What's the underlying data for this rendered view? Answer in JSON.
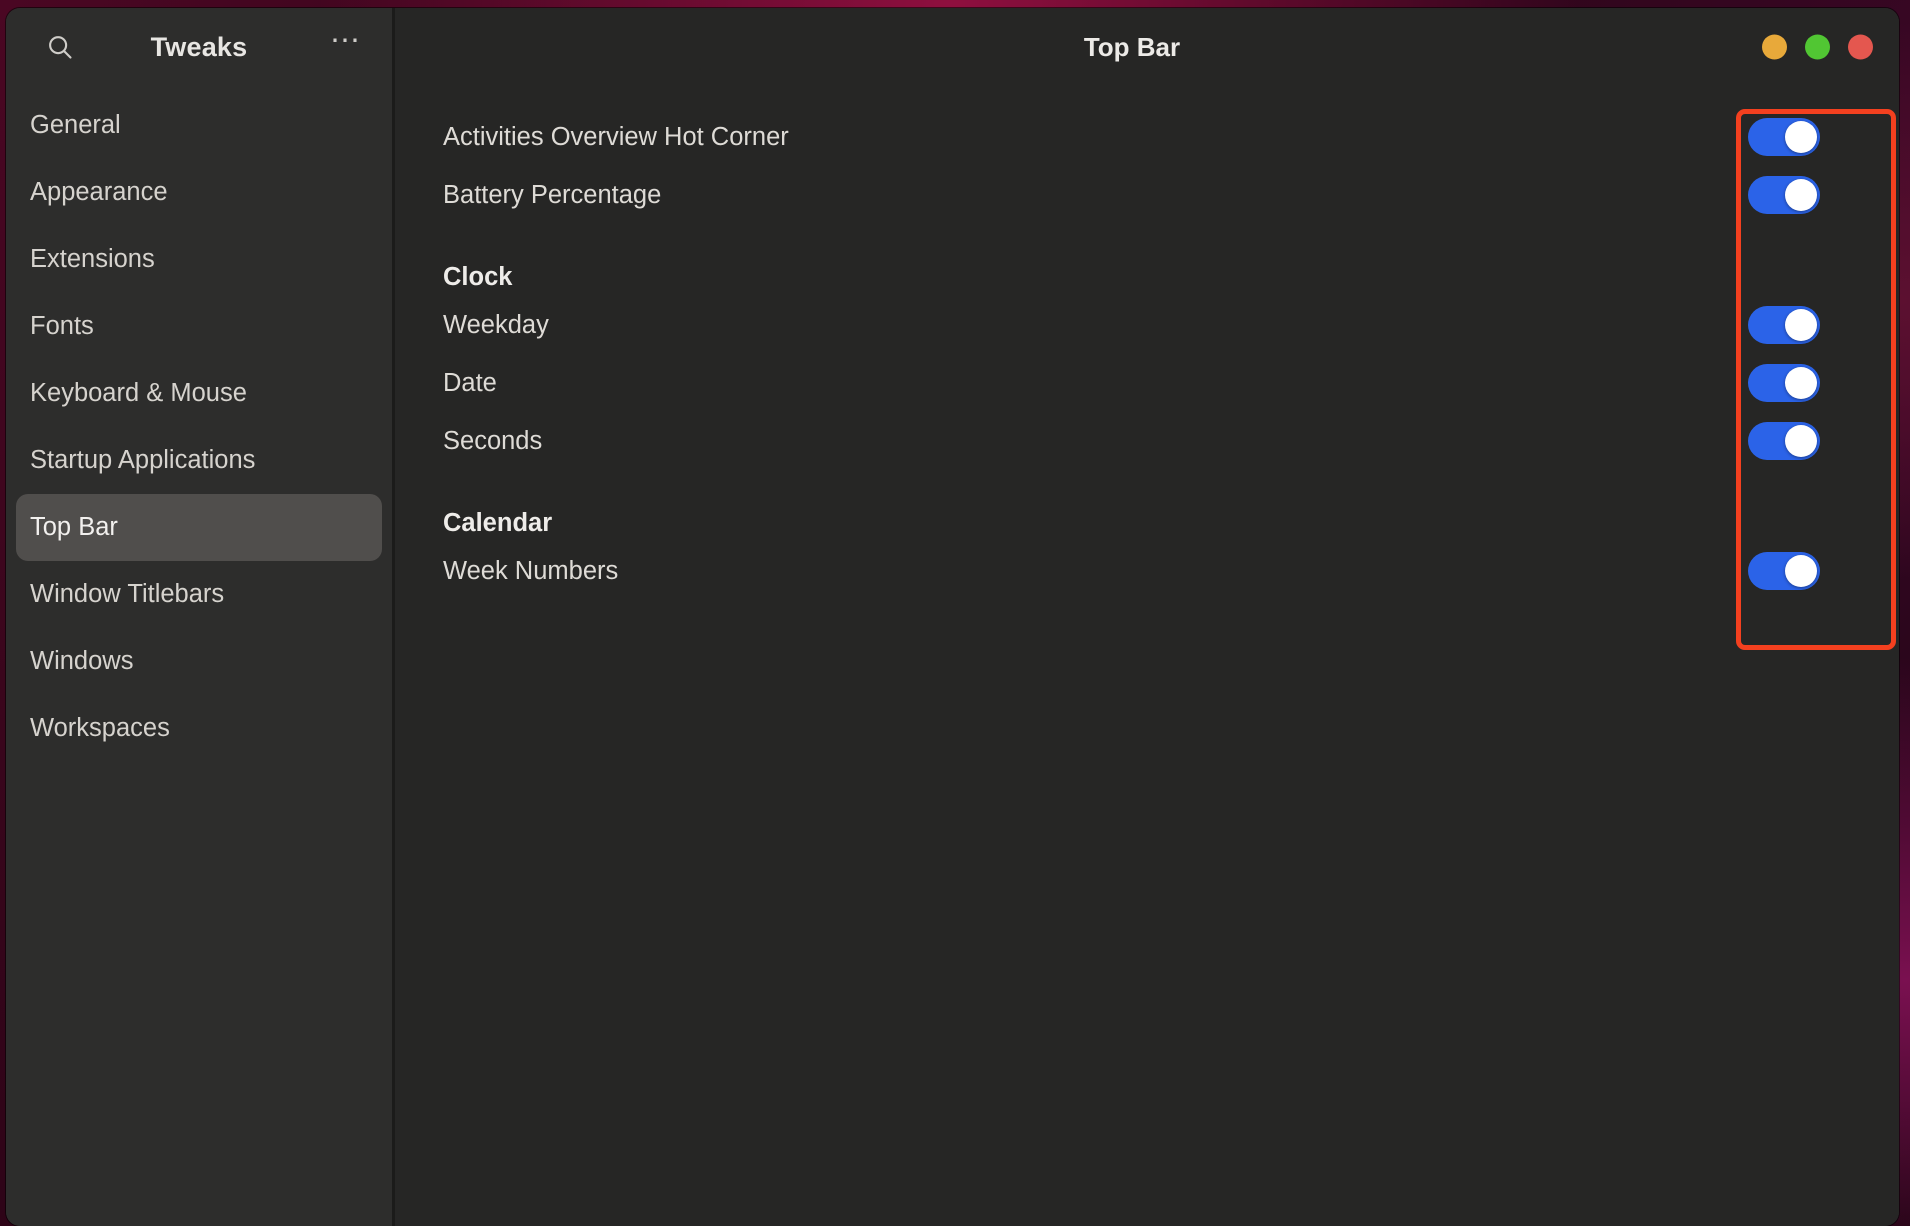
{
  "window": {
    "app_title": "Tweaks",
    "page_title": "Top Bar",
    "search_icon": "search-icon",
    "menu_icon": "ellipsis-menu-icon",
    "controls": [
      {
        "name": "minimize-button",
        "color": "#e8a93a"
      },
      {
        "name": "maximize-button",
        "color": "#51c633"
      },
      {
        "name": "close-button",
        "color": "#e4574f"
      }
    ]
  },
  "sidebar": {
    "items": [
      {
        "label": "General",
        "selected": false
      },
      {
        "label": "Appearance",
        "selected": false
      },
      {
        "label": "Extensions",
        "selected": false
      },
      {
        "label": "Fonts",
        "selected": false
      },
      {
        "label": "Keyboard & Mouse",
        "selected": false
      },
      {
        "label": "Startup Applications",
        "selected": false
      },
      {
        "label": "Top Bar",
        "selected": true
      },
      {
        "label": "Window Titlebars",
        "selected": false
      },
      {
        "label": "Windows",
        "selected": false
      },
      {
        "label": "Workspaces",
        "selected": false
      }
    ]
  },
  "main": {
    "rows": [
      {
        "label": "Activities Overview Hot Corner",
        "type": "switch",
        "value": "on"
      },
      {
        "label": "Battery Percentage",
        "type": "switch",
        "value": "on"
      },
      {
        "label": "Clock",
        "type": "group"
      },
      {
        "label": "Weekday",
        "type": "switch",
        "value": "on"
      },
      {
        "label": "Date",
        "type": "switch",
        "value": "on"
      },
      {
        "label": "Seconds",
        "type": "switch",
        "value": "on"
      },
      {
        "label": "Calendar",
        "type": "group"
      },
      {
        "label": "Week Numbers",
        "type": "switch",
        "value": "on"
      }
    ]
  },
  "annotation": {
    "name": "switch-column-highlight",
    "color": "#f4401f"
  },
  "colors": {
    "accent_toggle_on": "#2b63e8",
    "window_bg": "#262625",
    "sidebar_bg": "#2d2d2c",
    "sidebar_selected": "#504e4c",
    "text_primary": "#dedbd6",
    "annotation": "#f4401f"
  }
}
